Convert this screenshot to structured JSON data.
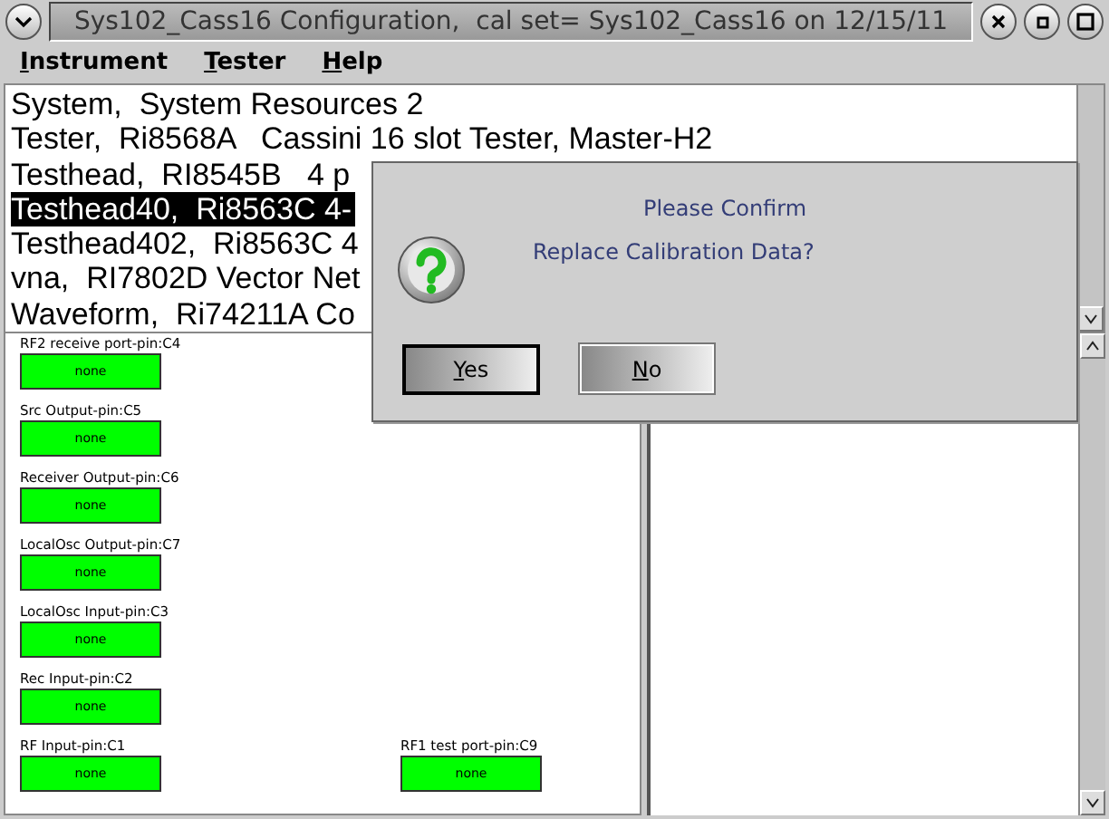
{
  "window": {
    "title": "Sys102_Cass16 Configuration,  cal set= Sys102_Cass16 on 12/15/11"
  },
  "menu": [
    {
      "label": "Instrument"
    },
    {
      "label": "Tester"
    },
    {
      "label": "Help"
    }
  ],
  "instruments": [
    {
      "text": "System,  System Resources 2",
      "selected": false
    },
    {
      "text": "Tester,  Ri8568A   Cassini 16 slot Tester, Master-H2",
      "selected": false
    },
    {
      "text": "Testhead,  RI8545B   4 p",
      "selected": false
    },
    {
      "text": "Testhead40,  Ri8563C 4-",
      "selected": true
    },
    {
      "text": "Testhead402,  Ri8563C 4",
      "selected": false
    },
    {
      "text": "vna,  RI7802D Vector Net",
      "selected": false
    },
    {
      "text": "Waveform,  Ri74211A Co",
      "selected": false
    }
  ],
  "pin_rows": [
    [
      {
        "label": "RF2 receive port-pin:C4",
        "value": "none"
      }
    ],
    [
      {
        "label": "Src Output-pin:C5",
        "value": "none"
      }
    ],
    [
      {
        "label": "Receiver Output-pin:C6",
        "value": "none"
      }
    ],
    [
      {
        "label": "LocalOsc Output-pin:C7",
        "value": "none"
      }
    ],
    [
      {
        "label": "LocalOsc Input-pin:C3",
        "value": "none"
      }
    ],
    [
      {
        "label": "Rec Input-pin:C2",
        "value": "none"
      }
    ],
    [
      {
        "label": "RF Input-pin:C1",
        "value": "none"
      },
      {
        "label": "RF1 test port-pin:C9",
        "value": "none"
      }
    ]
  ],
  "dialog": {
    "title": "Please Confirm",
    "message": "Replace Calibration Data?",
    "buttons": [
      {
        "label": "Yes",
        "default": true
      },
      {
        "label": "No",
        "default": false
      }
    ]
  }
}
